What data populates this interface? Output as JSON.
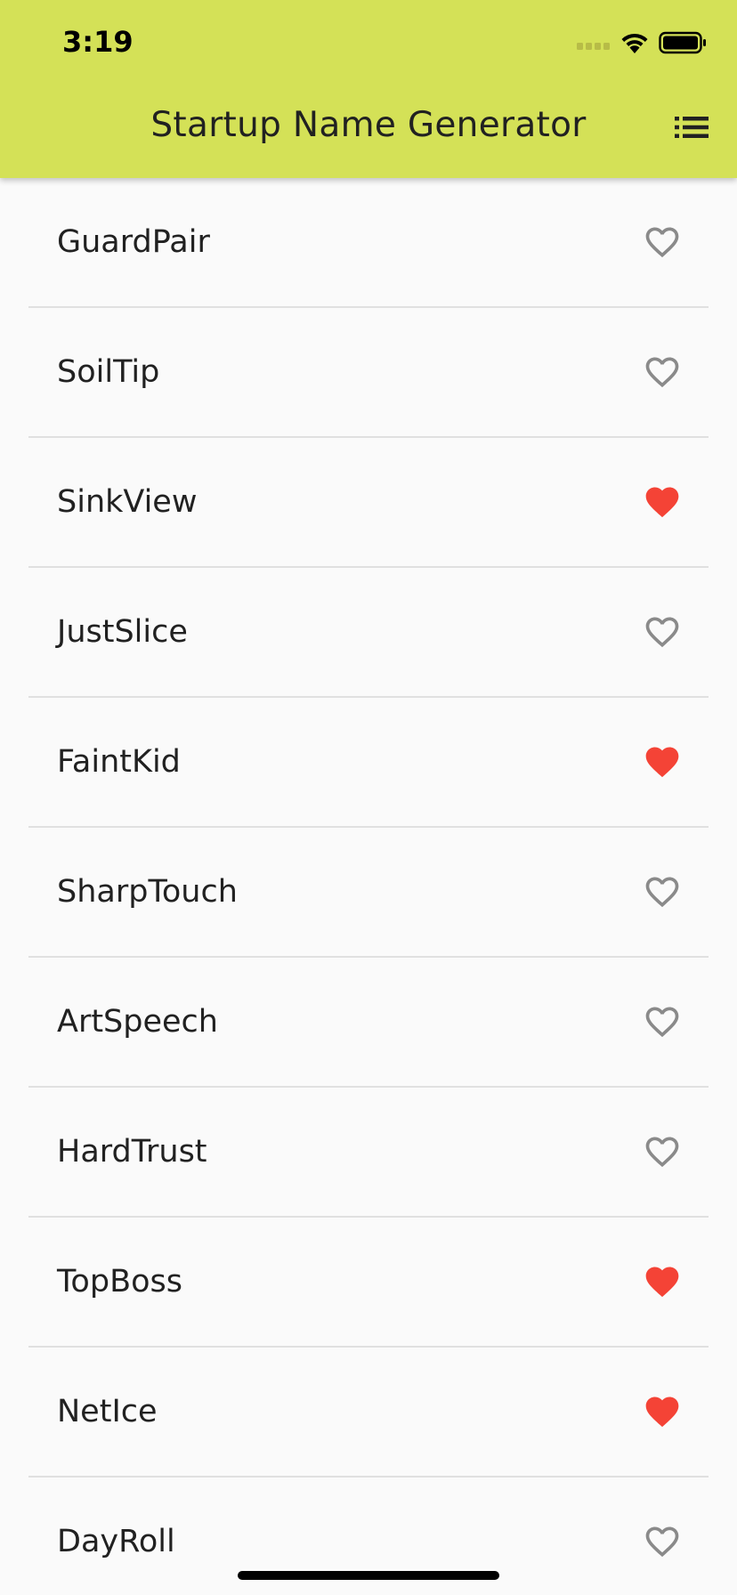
{
  "status_bar": {
    "time": "3:19",
    "icons": [
      "cellular-signal-icon",
      "wifi-icon",
      "battery-icon"
    ]
  },
  "app_bar": {
    "title": "Startup Name Generator",
    "action_icon": "list-icon",
    "background_color": "#d4e157"
  },
  "colors": {
    "favorite": "#f44336",
    "not_favorite": "#8a8a8a"
  },
  "suggestions": [
    {
      "name": "GuardPair",
      "saved": false
    },
    {
      "name": "SoilTip",
      "saved": false
    },
    {
      "name": "SinkView",
      "saved": true
    },
    {
      "name": "JustSlice",
      "saved": false
    },
    {
      "name": "FaintKid",
      "saved": true
    },
    {
      "name": "SharpTouch",
      "saved": false
    },
    {
      "name": "ArtSpeech",
      "saved": false
    },
    {
      "name": "HardTrust",
      "saved": false
    },
    {
      "name": "TopBoss",
      "saved": true
    },
    {
      "name": "NetIce",
      "saved": true
    },
    {
      "name": "DayRoll",
      "saved": false
    }
  ]
}
